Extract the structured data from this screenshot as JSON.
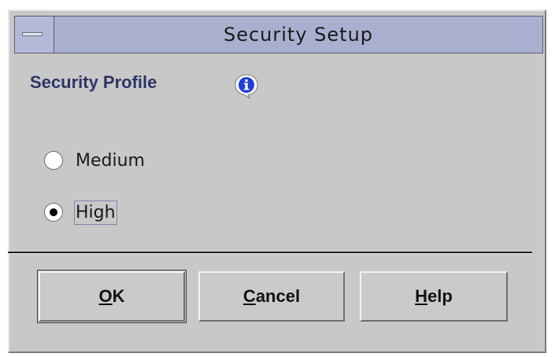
{
  "window": {
    "title": "Security Setup"
  },
  "profile": {
    "heading": "Security Profile",
    "info_icon": "info-icon",
    "options": [
      {
        "label": "Medium",
        "checked": false
      },
      {
        "label": "High",
        "checked": true
      }
    ]
  },
  "buttons": {
    "ok": {
      "mnemonic": "O",
      "rest": "K"
    },
    "cancel": {
      "mnemonic": "C",
      "rest": "ancel"
    },
    "help": {
      "mnemonic": "H",
      "rest": "elp"
    }
  },
  "colors": {
    "titlebar": "#a9b0cf",
    "window_bg": "#c8c8c8",
    "heading": "#2d3566",
    "info_icon_blue": "#1f3fd6"
  }
}
